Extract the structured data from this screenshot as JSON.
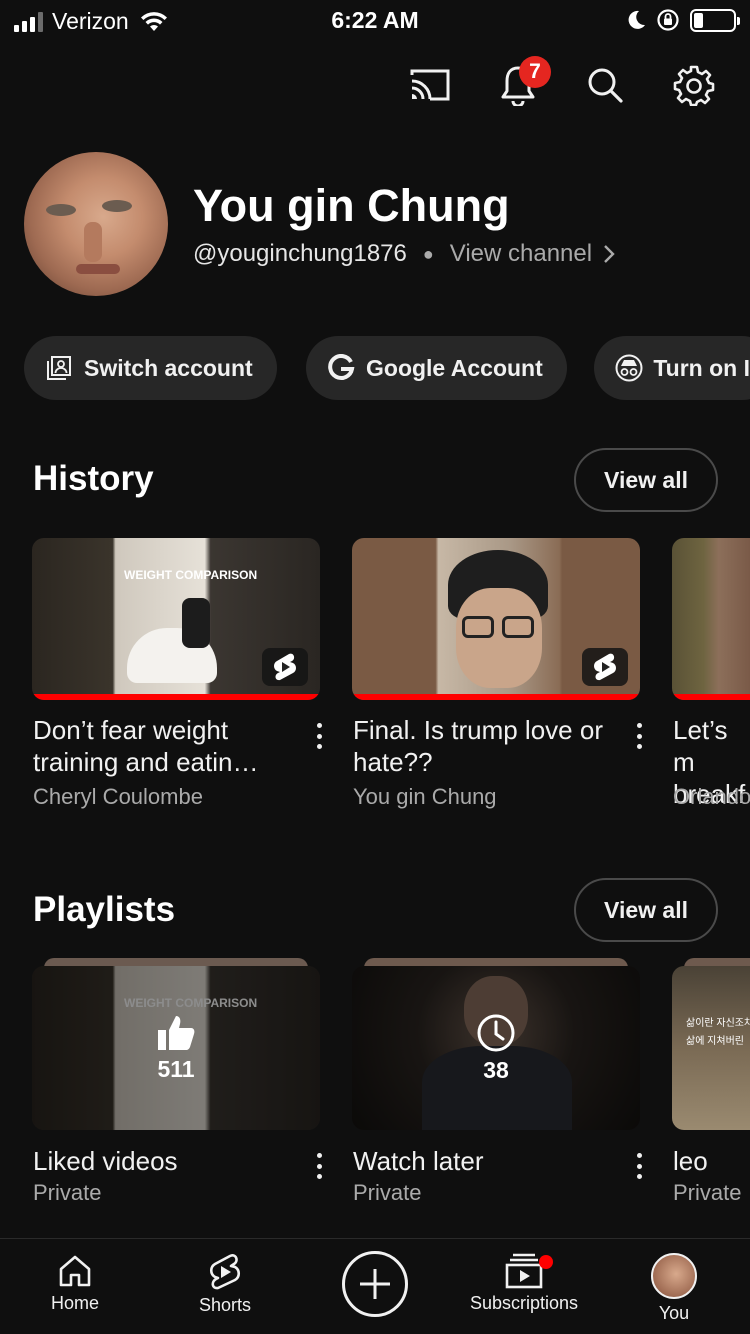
{
  "status_bar": {
    "carrier": "Verizon",
    "time": "6:22 AM"
  },
  "top_bar": {
    "notification_count": "7",
    "icons": [
      "cast-icon",
      "bell-icon",
      "search-icon",
      "gear-icon"
    ]
  },
  "profile": {
    "name": "You gin Chung",
    "handle": "@youginchung1876",
    "view_channel": "View channel"
  },
  "chips": [
    {
      "label": "Switch account",
      "icon": "switch-account-icon"
    },
    {
      "label": "Google Account",
      "icon": "google-g-icon"
    },
    {
      "label": "Turn on I",
      "icon": "incognito-icon"
    }
  ],
  "history": {
    "title": "History",
    "view_all": "View all",
    "items": [
      {
        "title": "Don’t fear weight training and eatin…",
        "channel": "Cheryl Coulombe",
        "thumb_caption": "WEIGHT COMPARISON",
        "watched_fraction": 1.0
      },
      {
        "title": "Final. Is trump love or hate??",
        "channel": "You gin Chung",
        "watched_fraction": 1.0
      },
      {
        "title": "Let’s m breakf",
        "channel": "Orlando",
        "watched_fraction": 1.0
      }
    ]
  },
  "playlists": {
    "title": "Playlists",
    "view_all": "View all",
    "items": [
      {
        "title": "Liked videos",
        "privacy": "Private",
        "count": "511",
        "icon": "thumbs-up-icon",
        "thumb_caption": "WEIGHT COMPARISON"
      },
      {
        "title": "Watch later",
        "privacy": "Private",
        "count": "38",
        "icon": "clock-icon"
      },
      {
        "title": "leo",
        "privacy": "Private",
        "thumb_caption_1": "삶이란 자신조차",
        "thumb_caption_2": "삶에 지쳐버린"
      }
    ]
  },
  "bottom_nav": {
    "items": [
      {
        "label": "Home",
        "icon": "home-icon"
      },
      {
        "label": "Shorts",
        "icon": "shorts-icon"
      },
      {
        "label": "",
        "icon": "create-plus-icon"
      },
      {
        "label": "Subscriptions",
        "icon": "subscriptions-icon"
      },
      {
        "label": "You",
        "icon": "avatar"
      }
    ]
  }
}
